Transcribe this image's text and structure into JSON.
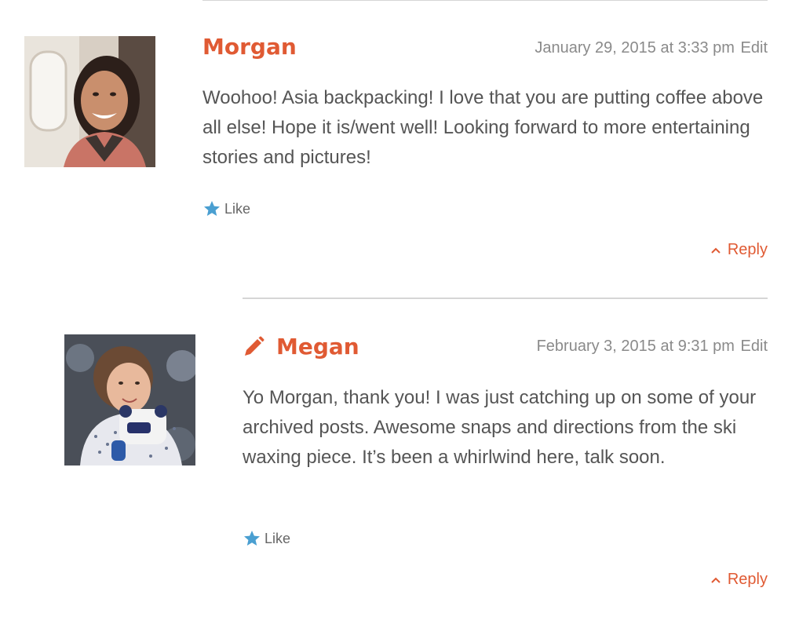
{
  "comments": [
    {
      "author": "Morgan",
      "date": "January 29, 2015 at 3:33 pm",
      "edit_label": "Edit",
      "text": "Woohoo! Asia backpacking! I love that you are putting coffee above all else! Hope it is/went well! Looking forward to more entertaining stories and pictures!",
      "like_label": "Like",
      "reply_label": "Reply",
      "is_post_author": false
    },
    {
      "author": "Megan",
      "date": "February 3, 2015 at 9:31 pm",
      "edit_label": "Edit",
      "text": "Yo Morgan, thank you! I was just catching up on some of your archived posts. Awesome snaps and directions from the ski waxing piece. It’s been a whirlwind here, talk soon.",
      "like_label": "Like",
      "reply_label": "Reply",
      "is_post_author": true
    }
  ],
  "colors": {
    "accent": "#e05a33",
    "meta": "#8a8a8a",
    "body_text": "#555555",
    "like_star": "#4a9fd1",
    "rule": "#d6d6d6"
  },
  "icons": {
    "like": "star-icon",
    "reply": "chevron-up-icon",
    "post_author": "pencil-icon"
  }
}
